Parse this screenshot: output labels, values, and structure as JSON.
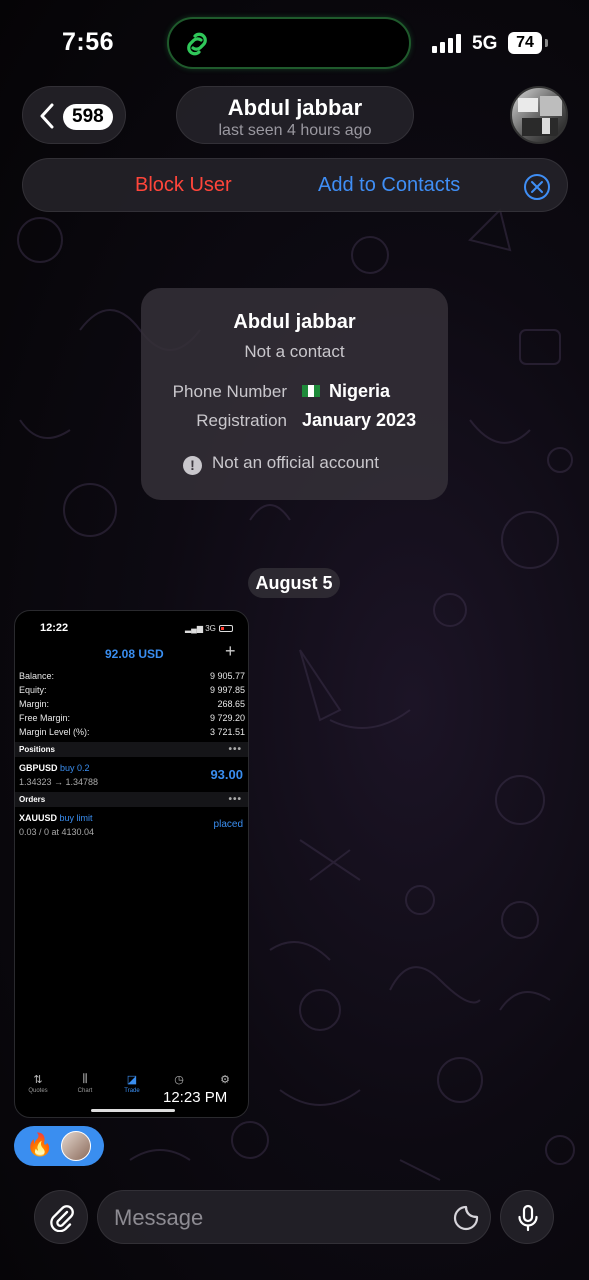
{
  "status_bar": {
    "time": "7:56",
    "network": "5G",
    "battery": "74"
  },
  "header": {
    "back_count": "598",
    "chat_name": "Abdul jabbar",
    "chat_status": "last seen 4 hours ago"
  },
  "action_bar": {
    "block": "Block User",
    "add": "Add to Contacts"
  },
  "info_card": {
    "name": "Abdul jabbar",
    "subtitle": "Not a contact",
    "rows": [
      {
        "label": "Phone Number",
        "value": "Nigeria"
      },
      {
        "label": "Registration",
        "value": "January 2023"
      }
    ],
    "official_note": "Not an official account"
  },
  "date_chip": "August 5",
  "screenshot": {
    "time": "12:22",
    "network": "3G",
    "balance": "92.08 USD",
    "rows": [
      {
        "label": "Balance:",
        "value": "9 905.77"
      },
      {
        "label": "Equity:",
        "value": "9 997.85"
      },
      {
        "label": "Margin:",
        "value": "268.65"
      },
      {
        "label": "Free Margin:",
        "value": "9 729.20"
      },
      {
        "label": "Margin Level (%):",
        "value": "3 721.51"
      }
    ],
    "positions_header": "Positions",
    "position": {
      "symbol": "GBPUSD",
      "side": "buy 0.2",
      "prices": "1.34323 → 1.34788",
      "profit": "93.00"
    },
    "orders_header": "Orders",
    "order": {
      "symbol": "XAUUSD",
      "side": "buy limit",
      "detail": "0.03 / 0 at 4130.04",
      "status": "placed"
    },
    "tabs": [
      "Quotes",
      "Chart",
      "Trade",
      "History",
      "Settings"
    ]
  },
  "message_time": "12:23 PM",
  "reaction": {
    "emoji": "🔥"
  },
  "input": {
    "placeholder": "Message"
  },
  "colors": {
    "accent": "#3f8ef5",
    "danger": "#ff453a",
    "online": "#30c85a"
  }
}
